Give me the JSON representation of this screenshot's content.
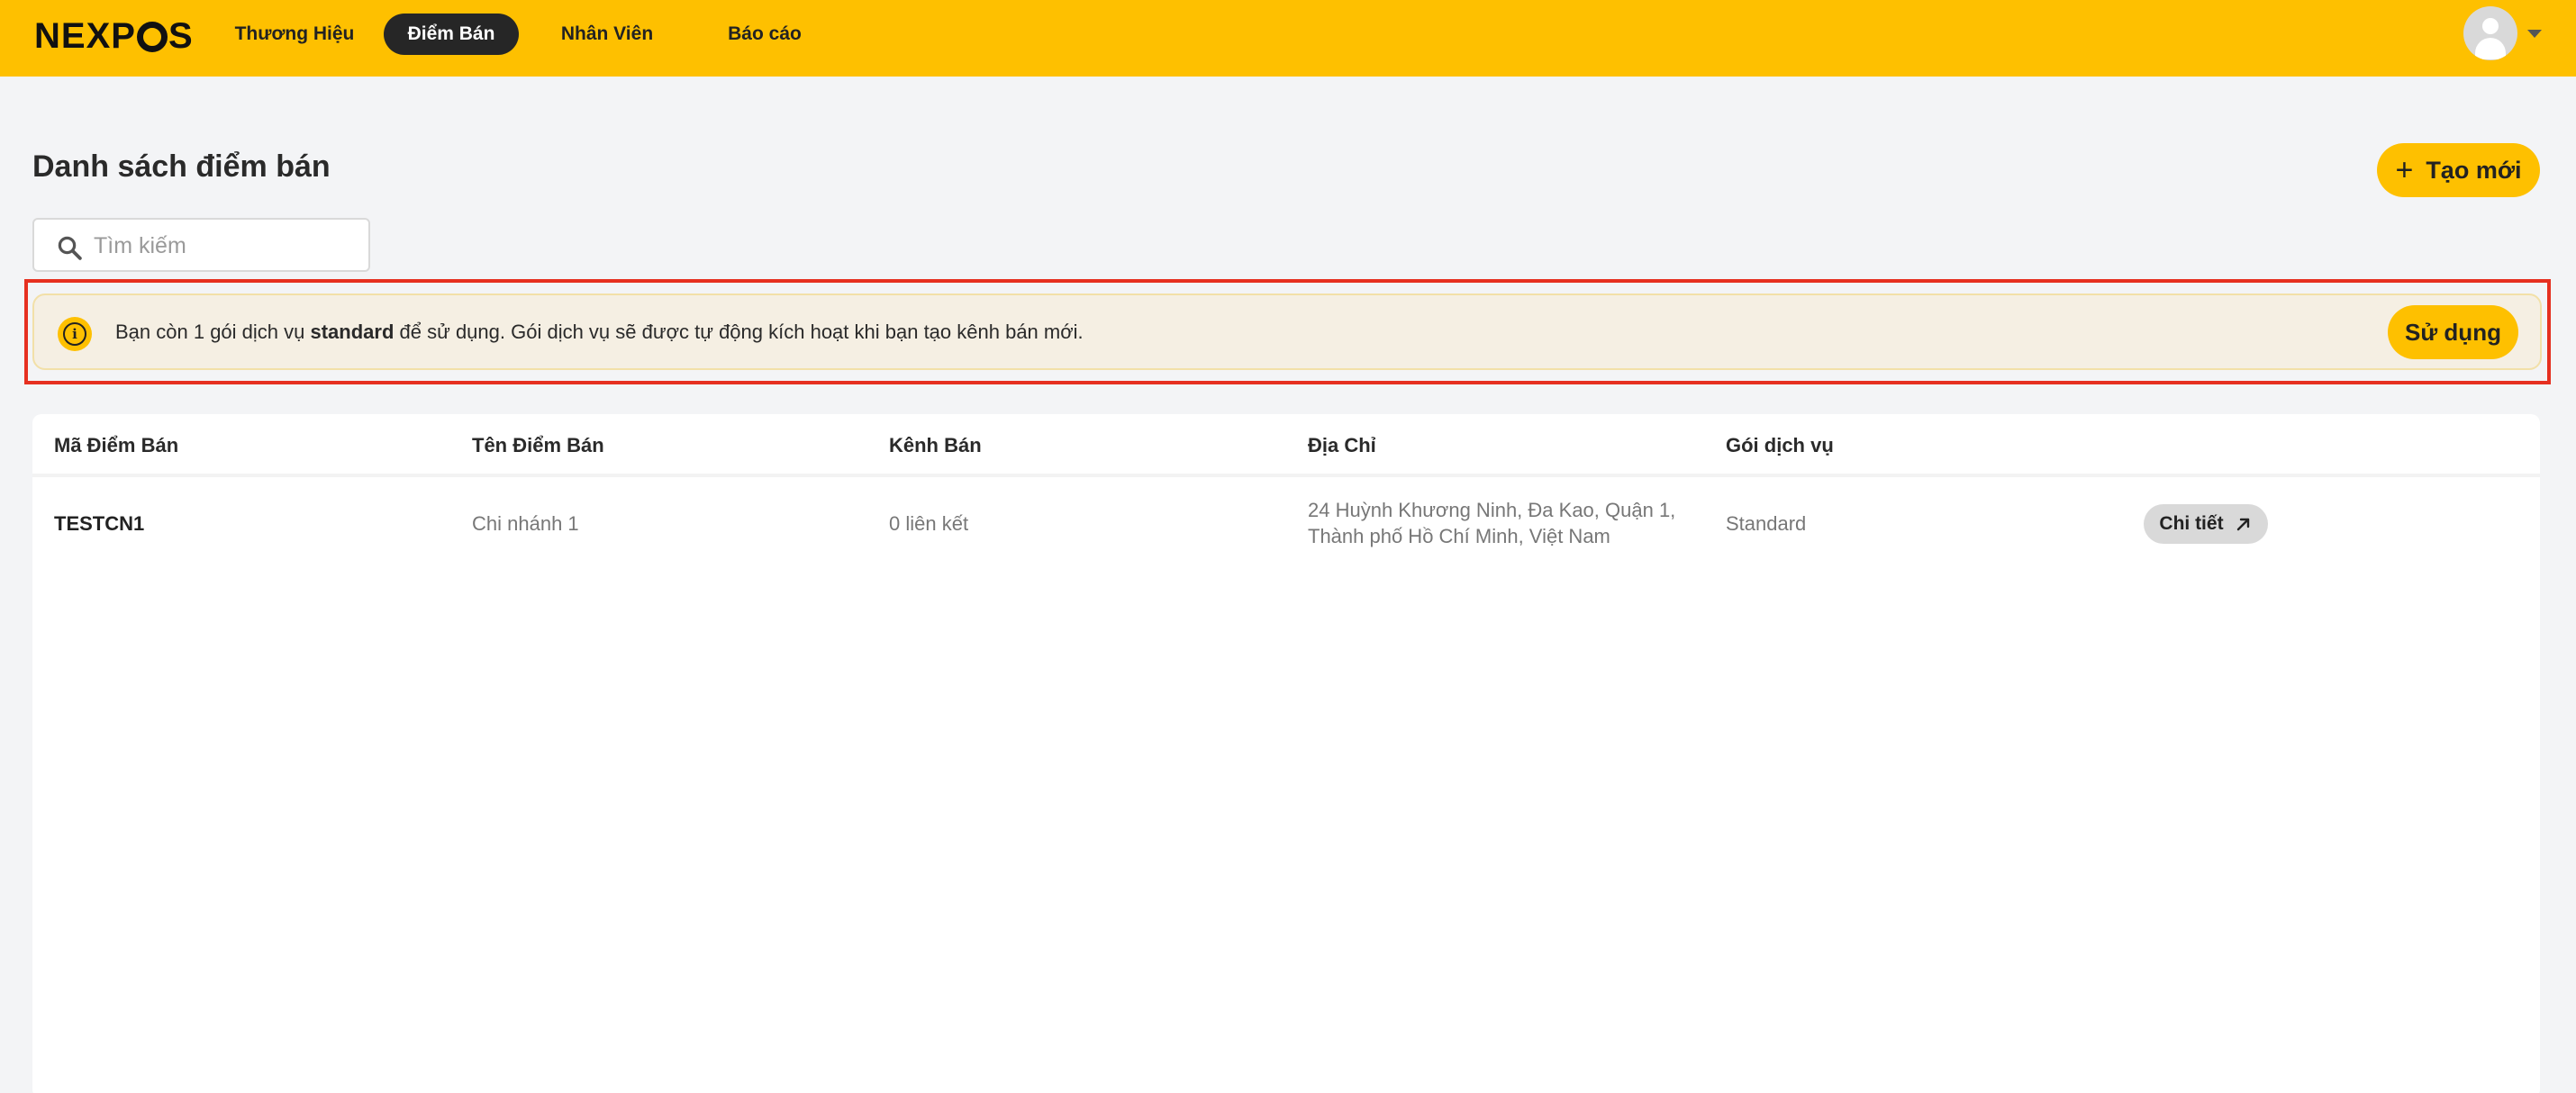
{
  "header": {
    "logo": "NEXPOS",
    "nav": [
      {
        "label": "Thương Hiệu",
        "active": false
      },
      {
        "label": "Điểm Bán",
        "active": true
      },
      {
        "label": "Nhân Viên",
        "active": false
      },
      {
        "label": "Báo cáo",
        "active": false
      }
    ],
    "brand_color": "#fec000"
  },
  "page": {
    "title": "Danh sách điểm bán",
    "create_label": "Tạo mới"
  },
  "search": {
    "placeholder": "Tìm kiếm",
    "value": ""
  },
  "notice": {
    "text_before": "Bạn còn 1 gói dịch vụ ",
    "text_bold": "standard",
    "text_after": " để sử dụng. Gói dịch vụ sẽ được tự động kích hoạt khi bạn tạo kênh bán mới.",
    "action_label": "Sử dụng",
    "highlight_color": "#e63020"
  },
  "table": {
    "columns": [
      "Mã Điểm Bán",
      "Tên Điểm Bán",
      "Kênh Bán",
      "Địa Chỉ",
      "Gói dịch vụ"
    ],
    "rows": [
      {
        "code": "TESTCN1",
        "name": "Chi nhánh 1",
        "channels": "0 liên kết",
        "address_line1": "24 Huỳnh Khương Ninh, Đa Kao, Quận 1,",
        "address_line2": "Thành phố Hồ Chí Minh, Việt Nam",
        "plan": "Standard",
        "action_label": "Chi tiết"
      }
    ]
  }
}
